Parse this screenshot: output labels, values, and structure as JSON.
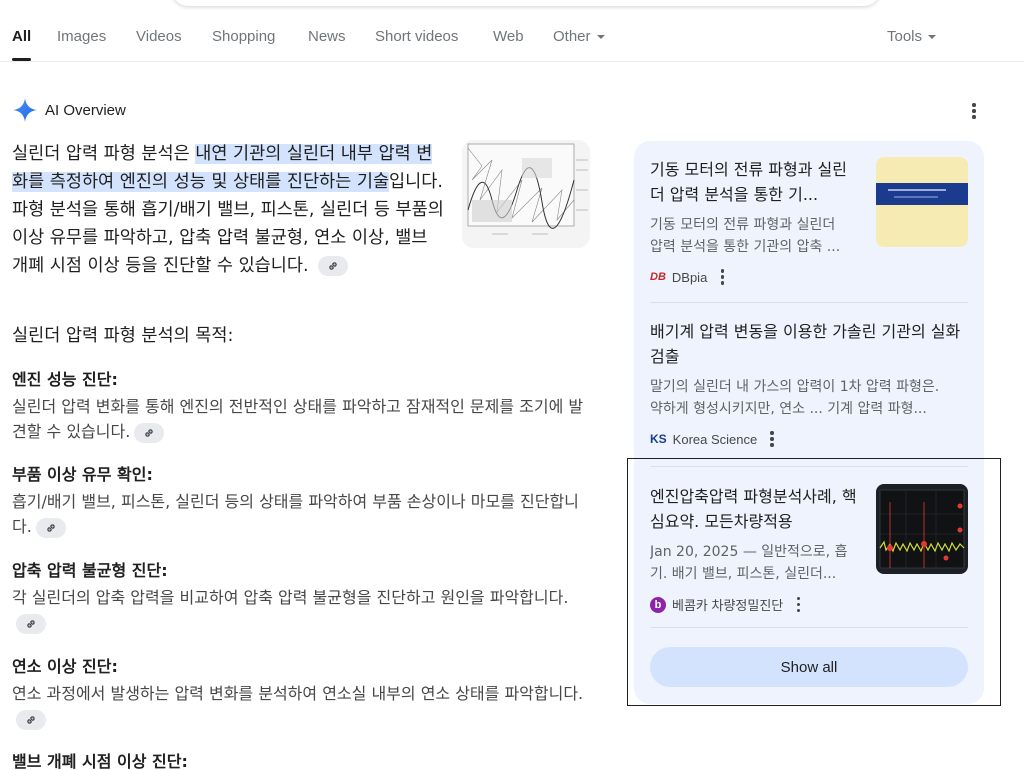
{
  "tabs": [
    {
      "label": "All",
      "active": true
    },
    {
      "label": "Images"
    },
    {
      "label": "Videos"
    },
    {
      "label": "Shopping"
    },
    {
      "label": "News"
    },
    {
      "label": "Short videos"
    },
    {
      "label": "Web"
    },
    {
      "label": "Other",
      "dropdown": true
    }
  ],
  "tools_label": "Tools",
  "ai_overview": {
    "title": "AI Overview",
    "intro": {
      "lead": "실린더 압력 파형 분석은 ",
      "highlight": "내연 기관의 실린더 내부 압력 변화를 측정하여 엔진의 성능 및 상태를 진단하는 기술",
      "rest": "입니다. 파형 분석을 통해 흡기/배기 밸브, 피스톤, 실린더 등 부품의 이상 유무를 파악하고, 압축 압력 불균형, 연소 이상, 밸브 개폐 시점 이상 등을 진단할 수 있습니다."
    },
    "purpose_heading": "실린더 압력 파형 분석의 목적:",
    "sections": [
      {
        "title": "엔진 성능 진단:",
        "body": "실린더 압력 변화를 통해 엔진의 전반적인 상태를 파악하고 잠재적인 문제를 조기에 발견할 수 있습니다."
      },
      {
        "title": "부품 이상 유무 확인:",
        "body": "흡기/배기 밸브, 피스톤, 실린더 등의 상태를 파악하여 부품 손상이나 마모를 진단합니다."
      },
      {
        "title": "압축 압력 불균형 진단:",
        "body": "각 실린더의 압축 압력을 비교하여 압축 압력 불균형을 진단하고 원인을 파악합니다."
      },
      {
        "title": "연소 이상 진단:",
        "body": "연소 과정에서 발생하는 압력 변화를 분석하여 연소실 내부의 연소 상태를 파악합니다."
      },
      {
        "title": "밸브 개폐 시점 이상 진단:",
        "body": ""
      }
    ]
  },
  "sources": [
    {
      "title": "기동 모터의 전류 파형과 실린더 압력 분석을 통한 기...",
      "desc_line1": "기동 모터의 전류 파형과 실린더",
      "desc_line2": "압력 분석을 통한 기관의 압축 ...",
      "source_name": "DBpia",
      "logo_text": "DB",
      "logo_color": "#c62828"
    },
    {
      "title": "배기계 압력 변동을 이용한 가솔린 기관의 실화 검출",
      "desc_line1": "말기의 실린더 내 가스의 압력이 1차 압력 파형은.",
      "desc_line2": "약하게 형성시키지만, 연소 ... 기계 압력 파형...",
      "source_name": "Korea Science",
      "logo_text": "KS",
      "logo_color": "#1a3e8c"
    },
    {
      "title": "엔진압축압력 파형분석사례, 핵심요약. 모든차량적용",
      "desc_line1": "Jan 20, 2025 — 일반적으로, 흡",
      "desc_line2": "기. 배기 밸브, 피스톤, 실린더...",
      "source_name": "베콤카 차량정밀진단",
      "logo_text": "b",
      "logo_color": "#8e24aa"
    }
  ],
  "show_all_label": "Show all"
}
